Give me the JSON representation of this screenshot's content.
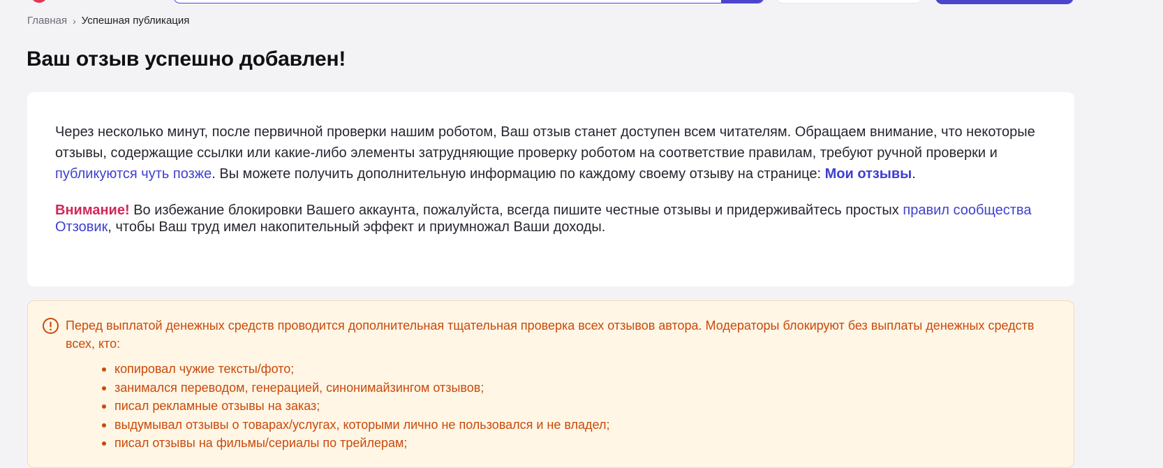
{
  "breadcrumb": {
    "home": "Главная",
    "separator": "›",
    "current": "Успешная публикация"
  },
  "page_title": "Ваш отзыв успешно добавлен!",
  "success_card": {
    "para1_text_a": "Через несколько минут, после первичной проверки нашим роботом, Ваш отзыв станет доступен всем читателям. Обращаем внимание, что некоторые отзывы, содержащие ссылки или какие-либо элементы затрудняющие проверку роботом на соответствие правилам, требуют ручной проверки и ",
    "para1_link": "публикуются чуть позже",
    "para1_text_b": ". Вы можете получить дополнительную информацию по каждому своему отзыву на странице: ",
    "my_reviews_link": "Мои отзывы",
    "para1_end": ".",
    "attention_label": "Внимание!",
    "para2_text_a": " Во избежание блокировки Вашего аккаунта, пожалуйста, всегда пишите честные отзывы и придерживайтесь простых ",
    "rules_link": "правил сообщества Отзовик",
    "para2_text_b": ", чтобы Ваш труд имел накопительный эффект и приумножал Ваши доходы."
  },
  "notice": {
    "icon": "exclamation-circle-icon",
    "text": "Перед выплатой денежных средств проводится дополнительная тщательная проверка всех отзывов автора. Модераторы блокируют без выплаты денежных средств всех, кто:",
    "items": [
      "копировал чужие тексты/фото;",
      "занимался переводом, генерацией, синонимайзингом отзывов;",
      "писал рекламные отзывы на заказ;",
      "выдумывал отзывы о товарах/услугах, которыми лично не пользовался и не владел;",
      "писал отзывы на фильмы/сериалы по трейлерам;"
    ]
  },
  "colors": {
    "accent": "#4a45cc",
    "link": "#3f3fd0",
    "attention": "#d2265a",
    "notice_text": "#c94a0a",
    "notice_bg": "#fff6e6",
    "page_bg": "#f3f3f6"
  }
}
